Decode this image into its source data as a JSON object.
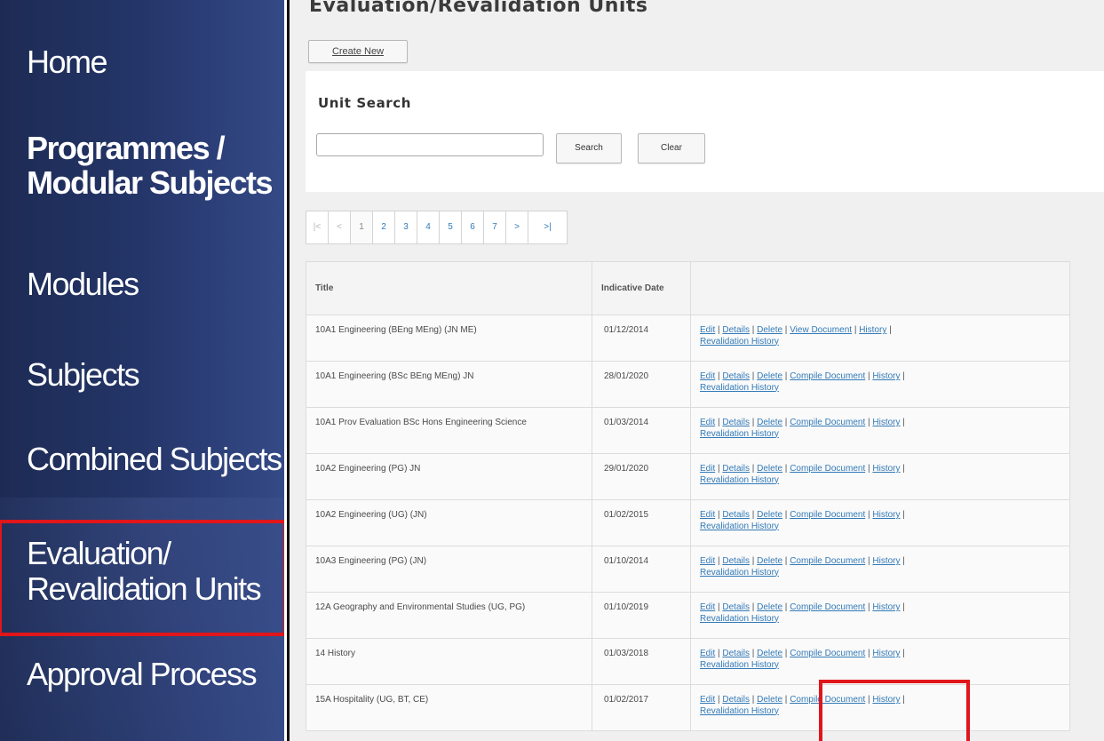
{
  "sidebar": {
    "items": [
      {
        "label": "Home"
      },
      {
        "line1": "Programmes /",
        "line2": "Modular Subjects"
      },
      {
        "label": "Modules"
      },
      {
        "label": "Subjects"
      },
      {
        "label": "Combined Subjects"
      },
      {
        "line1": "Evaluation/",
        "line2": "Revalidation Units"
      },
      {
        "label": "Approval Process"
      }
    ],
    "highlighted": "Evaluation/ Revalidation Units"
  },
  "main": {
    "title": "Evaluation/Revalidation Units",
    "create_label": "Create New",
    "search": {
      "title": "Unit Search",
      "value": "",
      "search_label": "Search",
      "clear_label": "Clear"
    },
    "pager": [
      "|<",
      "<",
      "1",
      "2",
      "3",
      "4",
      "5",
      "6",
      "7",
      ">",
      ">|"
    ],
    "table": {
      "headers": {
        "title": "Title",
        "date": "Indicative Date",
        "actions": ""
      },
      "link_labels": {
        "edit": "Edit",
        "details": "Details",
        "delete": "Delete",
        "view": "View Document",
        "compile": "Compile Document",
        "history": "History",
        "revalidation": "Revalidation History"
      },
      "rows": [
        {
          "title": "10A1 Engineering (BEng MEng) (JN ME)",
          "date": "01/12/2014",
          "doc": "View Document"
        },
        {
          "title": "10A1 Engineering (BSc BEng MEng) JN",
          "date": "28/01/2020",
          "doc": "Compile Document"
        },
        {
          "title": "10A1 Prov Evaluation BSc Hons Engineering Science",
          "date": "01/03/2014",
          "doc": "Compile Document"
        },
        {
          "title": "10A2 Engineering (PG) JN",
          "date": "29/01/2020",
          "doc": "Compile Document"
        },
        {
          "title": "10A2 Engineering (UG) (JN)",
          "date": "01/02/2015",
          "doc": "Compile Document"
        },
        {
          "title": "10A3 Engineering (PG) (JN)",
          "date": "01/10/2014",
          "doc": "Compile Document"
        },
        {
          "title": "12A Geography and Environmental Studies (UG, PG)",
          "date": "01/10/2019",
          "doc": "Compile Document"
        },
        {
          "title": "14 History",
          "date": "01/03/2018",
          "doc": "Compile Document"
        },
        {
          "title": "15A Hospitality (UG, BT, CE)",
          "date": "01/02/2017",
          "doc": "Compile Document"
        }
      ]
    }
  },
  "colors": {
    "highlight": "#e0161b",
    "sidebar_bg": "#233466",
    "link": "#337ab7"
  }
}
